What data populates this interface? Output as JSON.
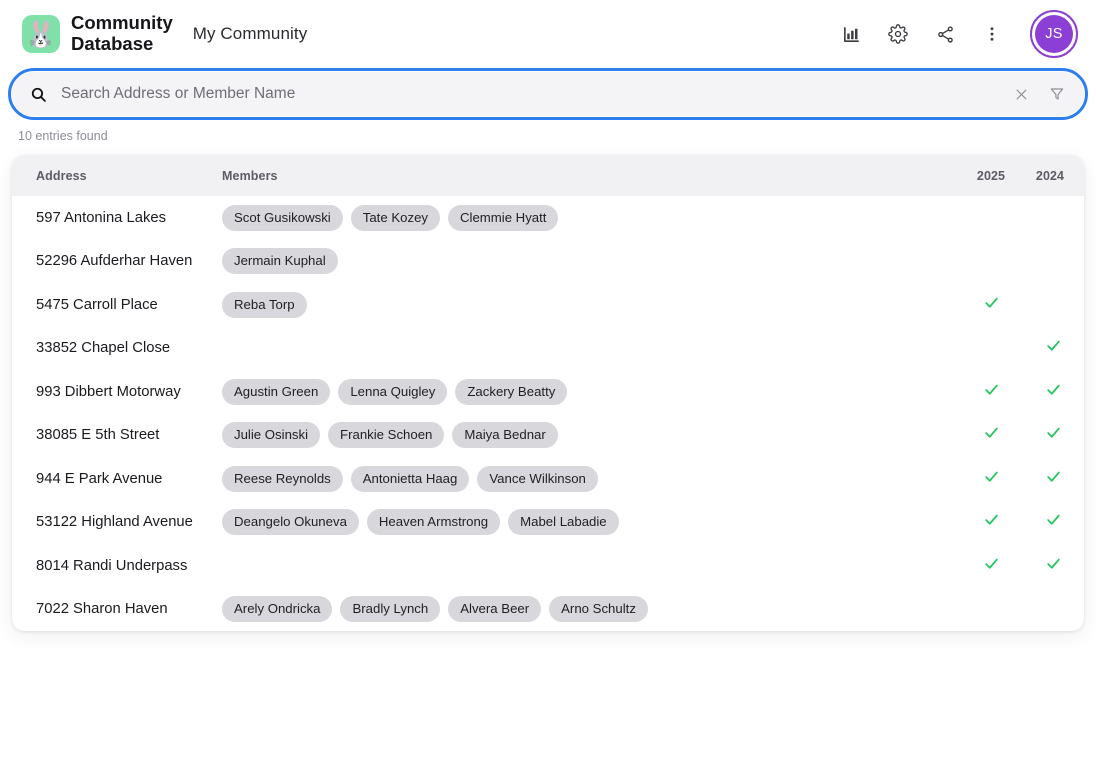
{
  "header": {
    "logo_icon": "rabbit-icon",
    "logo_bg": "#7fe0a8",
    "brand_line1": "Community",
    "brand_line2": "Database",
    "workspace_title": "My Community",
    "actions": [
      {
        "name": "chart-icon",
        "label": "Charts"
      },
      {
        "name": "gear-icon",
        "label": "Settings"
      },
      {
        "name": "share-icon",
        "label": "Share"
      },
      {
        "name": "more-vertical-icon",
        "label": "More"
      }
    ],
    "avatar": {
      "initials": "JS",
      "color": "#8b3fd4"
    }
  },
  "search": {
    "placeholder": "Search Address or Member Name",
    "value": "",
    "focus_ring_color": "#2d7ff0",
    "clear_icon": "close-icon",
    "filter_icon": "filter-icon",
    "results_text": "10 entries found"
  },
  "table": {
    "columns": {
      "address": "Address",
      "members": "Members",
      "year_2025": "2025",
      "year_2024": "2024"
    },
    "check_color": "#22c55e",
    "rows": [
      {
        "address": "597 Antonina Lakes",
        "members": [
          "Scot Gusikowski",
          "Tate Kozey",
          "Clemmie Hyatt"
        ],
        "y2025": false,
        "y2024": false
      },
      {
        "address": "52296 Aufderhar Haven",
        "members": [
          "Jermain Kuphal"
        ],
        "y2025": false,
        "y2024": false
      },
      {
        "address": "5475 Carroll Place",
        "members": [
          "Reba Torp"
        ],
        "y2025": true,
        "y2024": false
      },
      {
        "address": "33852 Chapel Close",
        "members": [],
        "y2025": false,
        "y2024": true
      },
      {
        "address": "993 Dibbert Motorway",
        "members": [
          "Agustin Green",
          "Lenna Quigley",
          "Zackery Beatty"
        ],
        "y2025": true,
        "y2024": true
      },
      {
        "address": "38085 E 5th Street",
        "members": [
          "Julie Osinski",
          "Frankie Schoen",
          "Maiya Bednar"
        ],
        "y2025": true,
        "y2024": true
      },
      {
        "address": "944 E Park Avenue",
        "members": [
          "Reese Reynolds",
          "Antonietta Haag",
          "Vance Wilkinson"
        ],
        "y2025": true,
        "y2024": true
      },
      {
        "address": "53122 Highland Avenue",
        "members": [
          "Deangelo Okuneva",
          "Heaven Armstrong",
          "Mabel Labadie"
        ],
        "y2025": true,
        "y2024": true
      },
      {
        "address": "8014 Randi Underpass",
        "members": [],
        "y2025": true,
        "y2024": true
      },
      {
        "address": "7022 Sharon Haven",
        "members": [
          "Arely Ondricka",
          "Bradly Lynch",
          "Alvera Beer",
          "Arno Schultz"
        ],
        "y2025": false,
        "y2024": false
      }
    ]
  }
}
